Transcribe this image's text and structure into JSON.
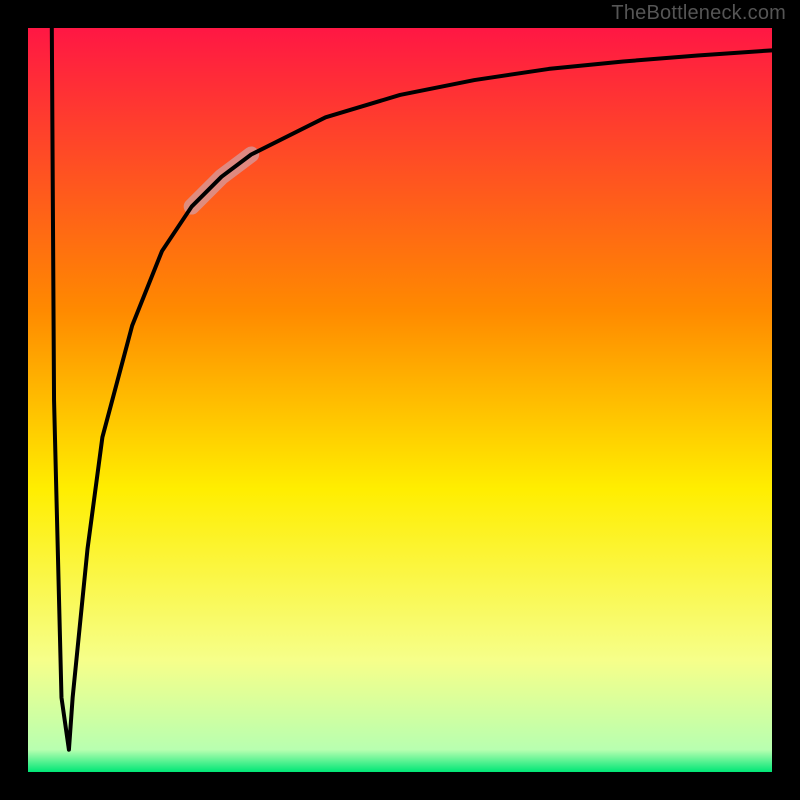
{
  "attribution": "TheBottleneck.com",
  "colors": {
    "gradient_top": "#ff1744",
    "gradient_mid1": "#ff6a00",
    "gradient_mid2": "#ffee00",
    "gradient_mid3": "#f6ff8a",
    "gradient_bottom": "#00e676",
    "curve": "#000000",
    "highlight": "#d49ca0",
    "frame": "#000000"
  },
  "chart_data": {
    "type": "line",
    "title": "",
    "xlabel": "",
    "ylabel": "",
    "xlim": [
      0,
      100
    ],
    "ylim": [
      0,
      100
    ],
    "grid": false,
    "legend": false,
    "series": [
      {
        "name": "bottleneck-curve-left-branch",
        "x": [
          3.2,
          3.5,
          4.5,
          5.5
        ],
        "y": [
          100,
          50,
          10,
          3
        ]
      },
      {
        "name": "bottleneck-curve-right-branch",
        "x": [
          5.5,
          6,
          8,
          10,
          14,
          18,
          22,
          26,
          30,
          40,
          50,
          60,
          70,
          80,
          90,
          100
        ],
        "y": [
          3,
          10,
          30,
          45,
          60,
          70,
          76,
          80,
          83,
          88,
          91,
          93,
          94.5,
          95.5,
          96.3,
          97
        ]
      },
      {
        "name": "highlight-segment",
        "x": [
          22,
          26,
          30
        ],
        "y": [
          76,
          80,
          83
        ]
      }
    ]
  }
}
